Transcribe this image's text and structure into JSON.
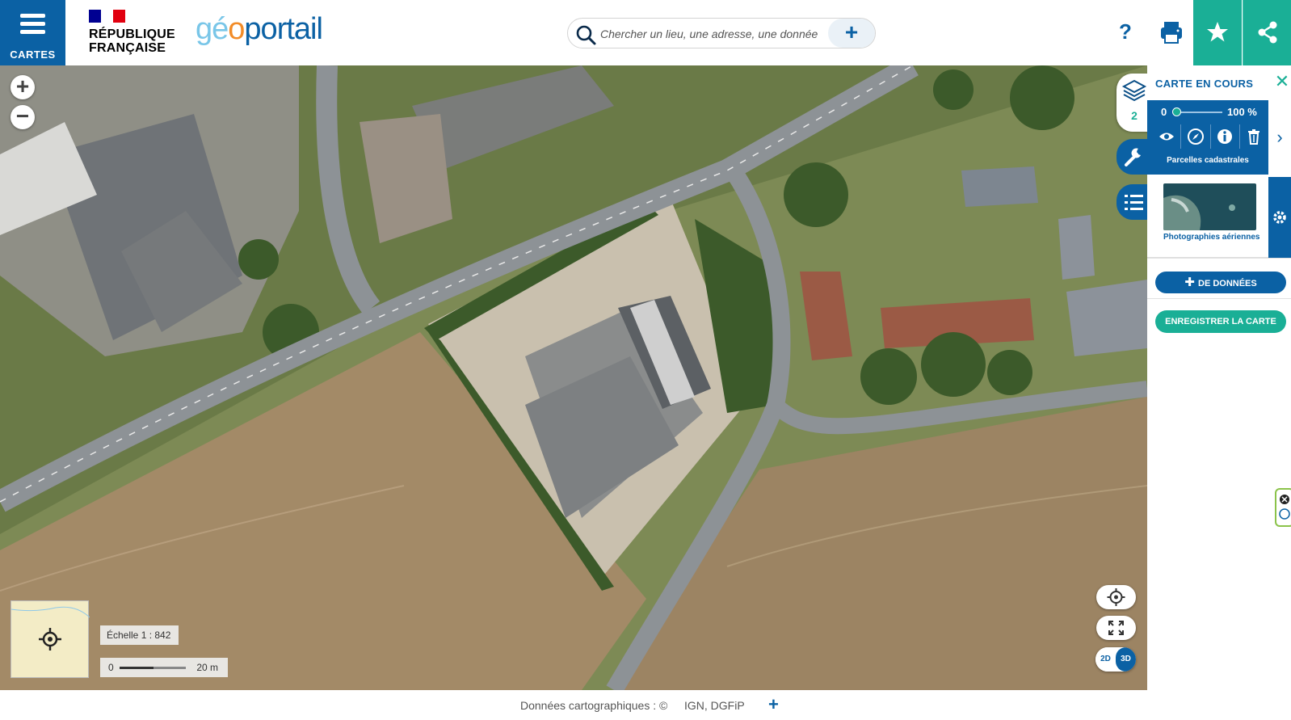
{
  "header": {
    "menu_label": "CARTES",
    "republique_line1": "RÉPUBLIQUE",
    "republique_line2": "FRANÇAISE",
    "logo_part1": "gé",
    "logo_part2": "o",
    "logo_part3": "portail",
    "search_placeholder": "Chercher un lieu, une adresse, une donnée",
    "search_plus": "+",
    "help_label": "?"
  },
  "map": {
    "zoom_in": "+",
    "zoom_out": "−",
    "scale_label": "Échelle 1 :  842",
    "scale_zero": "0",
    "scale_distance": "20 m",
    "mode_2d": "2D",
    "mode_3d": "3D"
  },
  "footer": {
    "attribution": "Données cartographiques : ©",
    "sources": "IGN,  DGFiP",
    "more": "+"
  },
  "sidebar": {
    "layers_count": "2"
  },
  "panel": {
    "title": "CARTE EN COURS",
    "close": "✕",
    "opacity_min": "0",
    "opacity_max": "100 %",
    "opacity_value": 0.05,
    "layer1_name": "Parcelles cadastrales",
    "layer2_name": "Photographies aériennes",
    "add_data": "DE DONNÉES",
    "save": "ENREGISTRER LA CARTE"
  },
  "colors": {
    "primary_blue": "#0b61a4",
    "accent_green": "#1aaf96",
    "logo_light_blue": "#79c6e8",
    "logo_orange": "#f28c28"
  },
  "icons": [
    "menu-icon",
    "search-icon",
    "plus-icon",
    "help-icon",
    "print-icon",
    "star-icon",
    "share-icon",
    "layers-icon",
    "wrench-icon",
    "legend-list-icon",
    "eye-icon",
    "compass-icon",
    "info-icon",
    "trash-icon",
    "chevron-right-icon",
    "gear-icon",
    "locate-icon",
    "fullscreen-icon",
    "close-icon"
  ]
}
